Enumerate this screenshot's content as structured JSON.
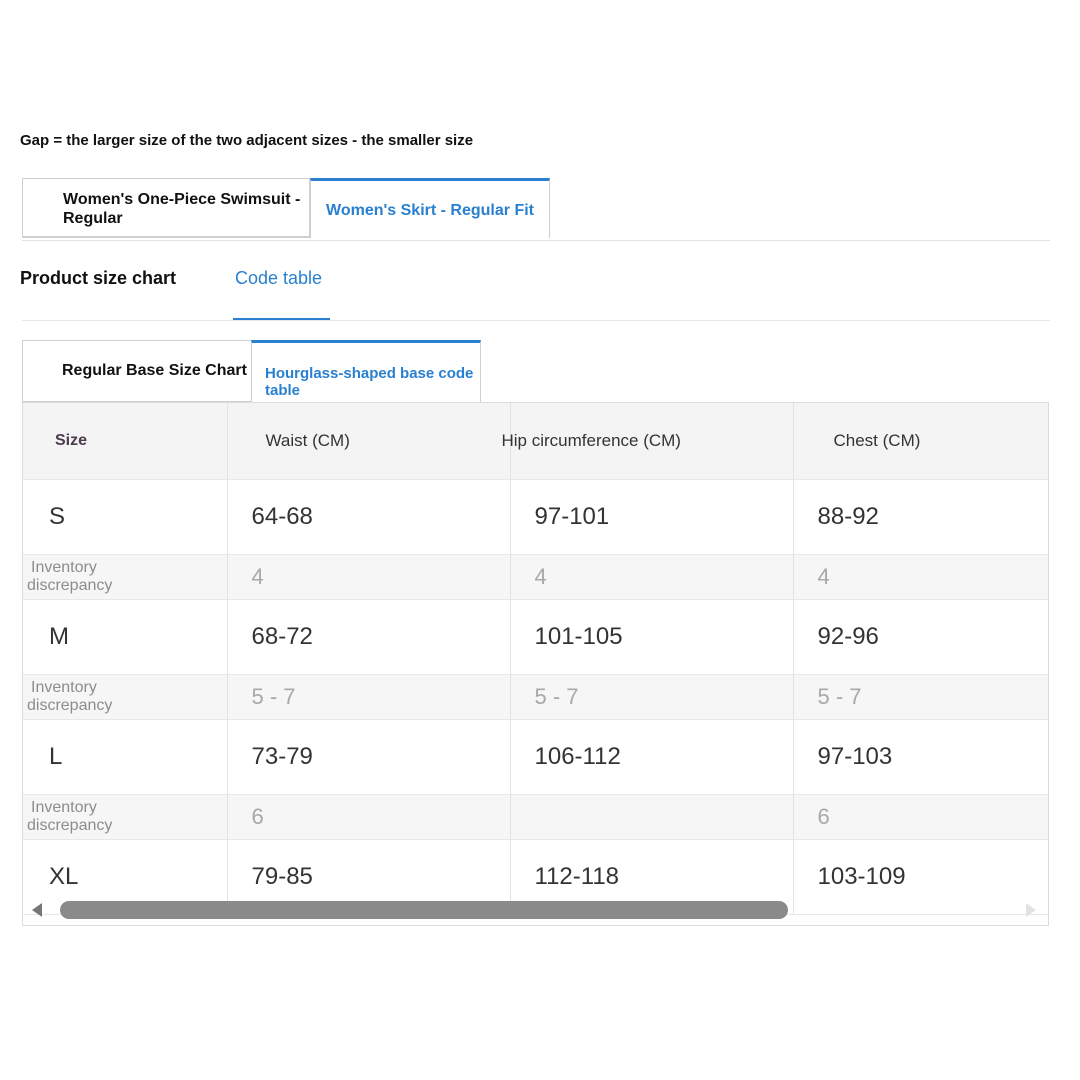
{
  "note": "Gap = the larger size of the two adjacent sizes - the smaller size",
  "product_tabs": [
    {
      "label": "Women's One-Piece Swimsuit - Regular",
      "active": false
    },
    {
      "label": "Women's Skirt - Regular Fit",
      "active": true
    }
  ],
  "section_tabs": [
    {
      "label": "Product size chart",
      "active": false
    },
    {
      "label": "Code table",
      "active": true
    }
  ],
  "chart_tabs": [
    {
      "label": "Regular Base Size Chart",
      "active": false
    },
    {
      "label": "Hourglass-shaped base code table",
      "active": true
    }
  ],
  "table": {
    "headers": [
      "Size",
      "Waist (CM)",
      "Hip circumference (CM)",
      "Chest (CM)"
    ],
    "gap_label_line1": "Inventory",
    "gap_label_line2": "discrepancy",
    "rows": [
      {
        "size": "S",
        "waist": "64-68",
        "hip": "97-101",
        "chest": "88-92"
      },
      {
        "gap": true,
        "waist": "4",
        "hip": "4",
        "chest": "4"
      },
      {
        "size": "M",
        "waist": "68-72",
        "hip": "101-105",
        "chest": "92-96"
      },
      {
        "gap": true,
        "waist": "5 - 7",
        "hip": "5 - 7",
        "chest": "5 - 7"
      },
      {
        "size": "L",
        "waist": "73-79",
        "hip": "106-112",
        "chest": "97-103"
      },
      {
        "gap": true,
        "waist": "6",
        "hip": "",
        "chest": "6"
      },
      {
        "size": "XL",
        "waist": "79-85",
        "hip": "112-118",
        "chest": "103-109"
      }
    ]
  },
  "scrollbar": {
    "position": 0,
    "visible_fraction": 0.76
  },
  "colors": {
    "accent": "#2a80d0",
    "header_bg": "#f4f4f4",
    "gap_bg": "#f6f6f6"
  }
}
